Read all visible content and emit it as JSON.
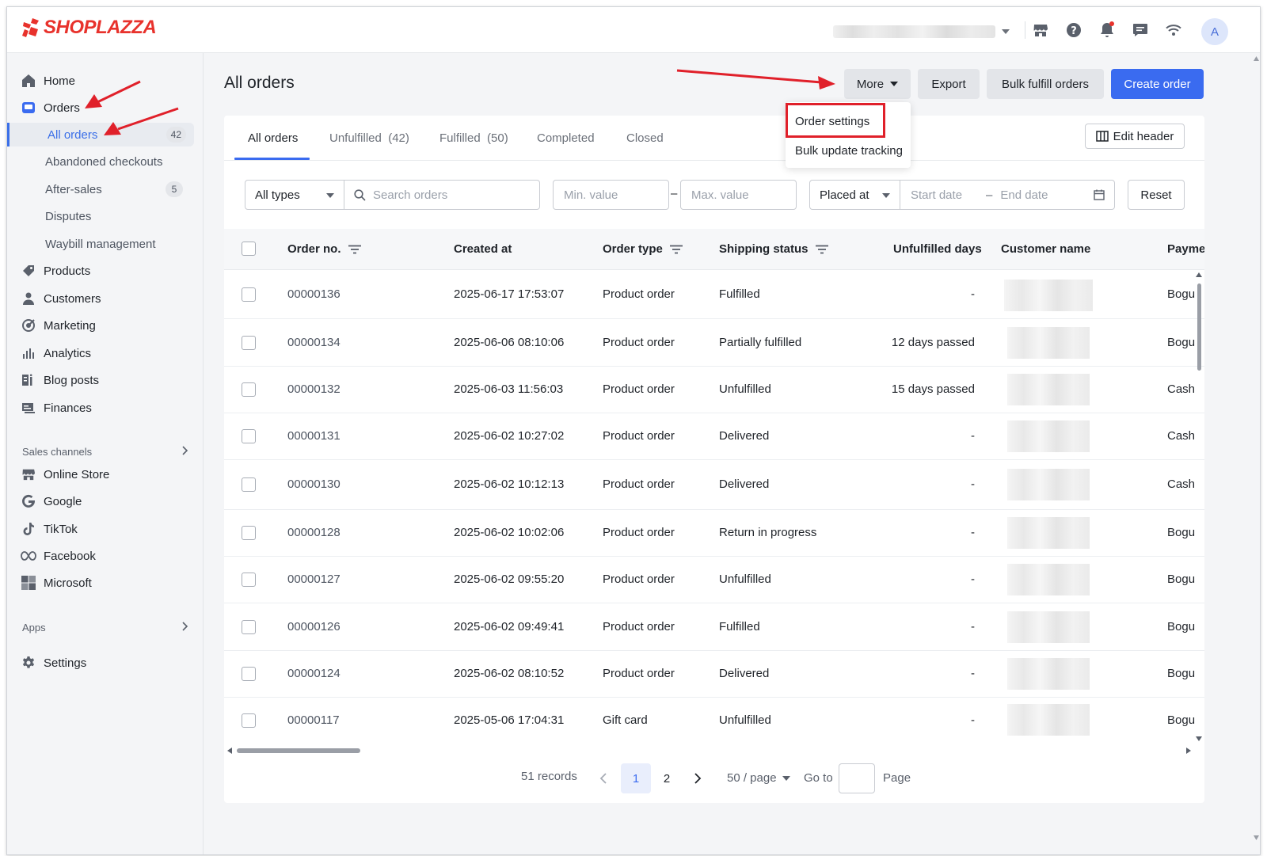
{
  "brand": {
    "name": "SHOPLAZZA",
    "color": "#e8322c"
  },
  "topbar": {
    "icons": [
      "store-icon",
      "help-icon",
      "bell-icon",
      "chat-icon",
      "wifi-icon"
    ],
    "avatar_letter": "A"
  },
  "sidebar": {
    "home": "Home",
    "orders": "Orders",
    "orders_sub": [
      {
        "label": "All orders",
        "badge": "42"
      },
      {
        "label": "Abandoned checkouts"
      },
      {
        "label": "After-sales",
        "badge": "5"
      },
      {
        "label": "Disputes"
      },
      {
        "label": "Waybill management"
      }
    ],
    "products": "Products",
    "customers": "Customers",
    "marketing": "Marketing",
    "analytics": "Analytics",
    "blog_posts": "Blog posts",
    "finances": "Finances",
    "sales_channels_label": "Sales channels",
    "online_store": "Online Store",
    "google": "Google",
    "tiktok": "TikTok",
    "facebook": "Facebook",
    "microsoft": "Microsoft",
    "apps_label": "Apps",
    "settings": "Settings"
  },
  "header": {
    "title": "All orders",
    "more": "More",
    "export": "Export",
    "bulk_fulfill": "Bulk fulfill orders",
    "create_order": "Create order",
    "accent": "#3a6bf0"
  },
  "more_menu": {
    "order_settings": "Order settings",
    "bulk_update_tracking": "Bulk update tracking"
  },
  "tabs": {
    "all": "All orders",
    "unfulfilled": "Unfulfilled  (42)",
    "fulfilled": "Fulfilled  (50)",
    "completed": "Completed",
    "closed": "Closed",
    "edit_header": "Edit header"
  },
  "filters": {
    "type": "All types",
    "search_placeholder": "Search orders",
    "min_placeholder": "Min. value",
    "dash": "–",
    "max_placeholder": "Max. value",
    "date_field": "Placed at",
    "start_placeholder": "Start date",
    "end_placeholder": "End date",
    "reset": "Reset"
  },
  "table": {
    "columns": {
      "order_no": "Order no.",
      "created_at": "Created at",
      "order_type": "Order type",
      "shipping_status": "Shipping status",
      "unfulfilled_days": "Unfulfilled days",
      "customer_name": "Customer name",
      "payment": "Paymer"
    },
    "rows": [
      {
        "order_no": "00000136",
        "created_at": "2025-06-17 17:53:07",
        "order_type": "Product order",
        "shipping_status": "Fulfilled",
        "unfulfilled_days": "-",
        "payment": "Bogu"
      },
      {
        "order_no": "00000134",
        "created_at": "2025-06-06 08:10:06",
        "order_type": "Product order",
        "shipping_status": "Partially fulfilled",
        "unfulfilled_days": "12 days passed",
        "payment": "Bogu"
      },
      {
        "order_no": "00000132",
        "created_at": "2025-06-03 11:56:03",
        "order_type": "Product order",
        "shipping_status": "Unfulfilled",
        "unfulfilled_days": "15 days passed",
        "payment": "Cash"
      },
      {
        "order_no": "00000131",
        "created_at": "2025-06-02 10:27:02",
        "order_type": "Product order",
        "shipping_status": "Delivered",
        "unfulfilled_days": "-",
        "payment": "Cash"
      },
      {
        "order_no": "00000130",
        "created_at": "2025-06-02 10:12:13",
        "order_type": "Product order",
        "shipping_status": "Delivered",
        "unfulfilled_days": "-",
        "payment": "Cash"
      },
      {
        "order_no": "00000128",
        "created_at": "2025-06-02 10:02:06",
        "order_type": "Product order",
        "shipping_status": "Return in progress",
        "unfulfilled_days": "-",
        "payment": "Bogu"
      },
      {
        "order_no": "00000127",
        "created_at": "2025-06-02 09:55:20",
        "order_type": "Product order",
        "shipping_status": "Unfulfilled",
        "unfulfilled_days": "-",
        "payment": "Bogu"
      },
      {
        "order_no": "00000126",
        "created_at": "2025-06-02 09:49:41",
        "order_type": "Product order",
        "shipping_status": "Fulfilled",
        "unfulfilled_days": "-",
        "payment": "Bogu"
      },
      {
        "order_no": "00000124",
        "created_at": "2025-06-02 08:10:52",
        "order_type": "Product order",
        "shipping_status": "Delivered",
        "unfulfilled_days": "-",
        "payment": "Bogu"
      },
      {
        "order_no": "00000117",
        "created_at": "2025-05-06 17:04:31",
        "order_type": "Gift card",
        "shipping_status": "Unfulfilled",
        "unfulfilled_days": "-",
        "payment": "Bogu"
      }
    ]
  },
  "pagination": {
    "records": "51 records",
    "pages": [
      "1",
      "2"
    ],
    "per_page": "50 / page",
    "goto": "Go to",
    "page_word": "Page"
  },
  "annotations": {
    "color": "#e0202a"
  }
}
